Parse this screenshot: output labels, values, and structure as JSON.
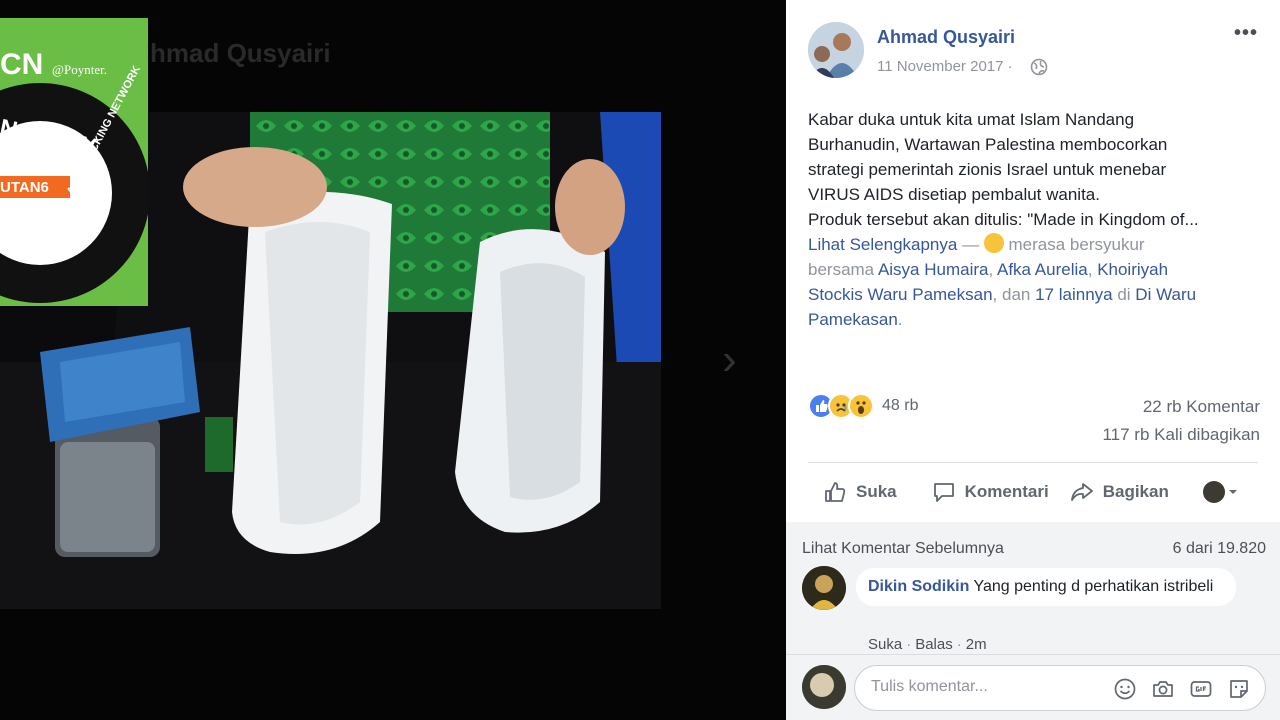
{
  "media": {
    "ghost_name": "hmad Qusyairi"
  },
  "badge": {
    "ifcn": "CN",
    "poynter": "@Poynter.",
    "ring_top": "NATORY",
    "ring_bottom": "ACT-CHECKING NETWORK",
    "logo": "UTAN6"
  },
  "post": {
    "author": "Ahmad Qusyairi",
    "date": "11 November 2017 ·",
    "more": "•••",
    "text_lines": [
      "Kabar duka untuk kita umat Islam Nandang",
      "Burhanudin, Wartawan Palestina membocorkan",
      "strategi pemerintah zionis Israel untuk menebar",
      "VIRUS AIDS disetiap pembalut wanita.",
      "Produk tersebut akan ditulis: \"Made in Kingdom of..."
    ],
    "see_more": "Lihat Selengkapnya",
    "dash": " — ",
    "feeling": " merasa bersyukur",
    "with": "bersama ",
    "tag1": "Aisya Humaira",
    "comma": ", ",
    "tag2": "Afka Aurelia",
    "tag3": "Khoiriyah",
    "tag3b": "Stockis Waru Pameksan",
    "and": ", dan ",
    "others": "17 lainnya",
    "at": " di ",
    "place": "Di Waru",
    "place2": "Pamekasan",
    "period": "."
  },
  "stats": {
    "reactions": "48 rb",
    "comments": "22 rb Komentar",
    "shares": "117 rb Kali dibagikan",
    "reaction_icons": [
      "like-icon",
      "sad-icon",
      "wow-icon"
    ]
  },
  "actions": {
    "like": "Suka",
    "comment": "Komentari",
    "share": "Bagikan"
  },
  "comments": {
    "prev_link": "Lihat Komentar Sebelumnya",
    "count": "6 dari 19.820",
    "items": [
      {
        "name": "Dikin Sodikin",
        "text": " Yang penting d perhatikan istribeli",
        "like": "Suka",
        "reply": "Balas",
        "time": "2m"
      }
    ],
    "sep": "·",
    "input_placeholder": "Tulis komentar..."
  },
  "colors": {
    "link": "#365899",
    "muted": "#90949c",
    "ifcn_green": "#6abd45",
    "like_blue": "#4a7ff0"
  }
}
